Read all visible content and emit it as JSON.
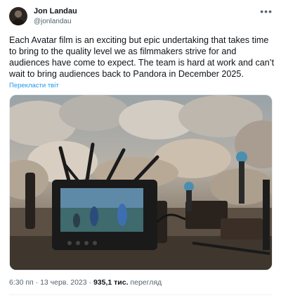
{
  "author": {
    "name": "Jon Landau",
    "handle": "@jonlandau"
  },
  "tweet": {
    "text": "Each Avatar film is an exciting but epic undertaking that takes time to bring to the quality level we as filmmakers strive for and audiences have come to expect. The team is hard at work and can’t wait to bring audiences back to Pandora in December 2025.",
    "translate_label": "Перекласти твіт"
  },
  "footer": {
    "time": "6:30 пп",
    "date": "13 черв. 2023",
    "separator": "·",
    "views_count": "935,1 тис.",
    "views_label": "перегляд"
  },
  "icons": {
    "more": "more-options-icon"
  },
  "colors": {
    "link": "#1d9bf0",
    "secondary_text": "#536471",
    "primary_text": "#0f1419"
  }
}
